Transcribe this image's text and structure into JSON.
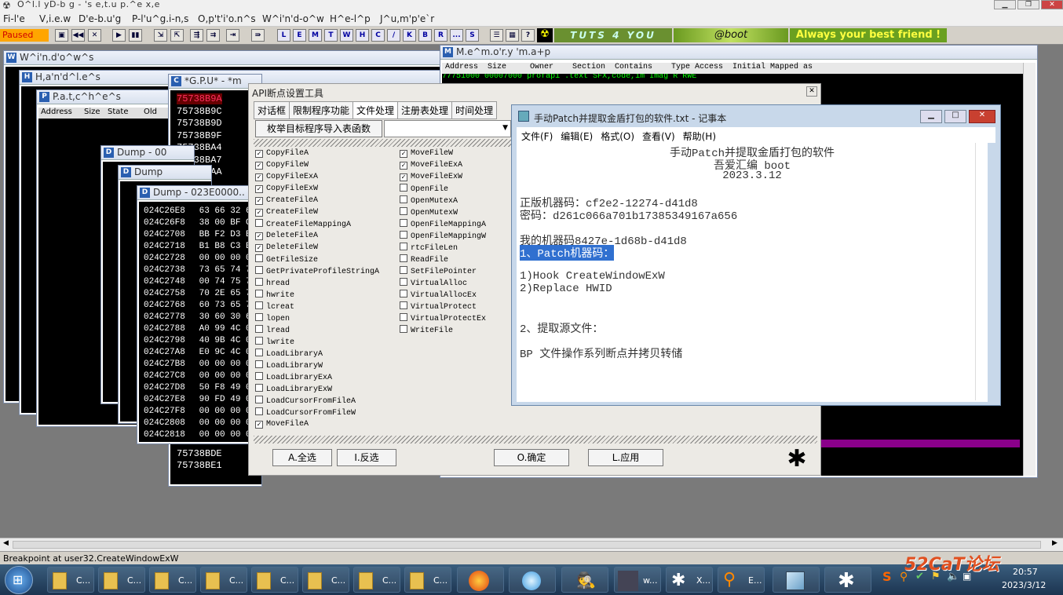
{
  "app": {
    "title": "O^l.l yD-b g - 's e,t.u p.^e x,e"
  },
  "menu": [
    "Fi-l'e",
    "V,i.e.w",
    "D'e-b.u'g",
    "P-l'u^g.i-n,s",
    "O,p't'i'o.n^s",
    "W^i'n'd-o^w",
    "H^e-l^p",
    "J^u,m'p'e`r"
  ],
  "toolbar": {
    "status": "Paused",
    "letters": [
      "L",
      "E",
      "M",
      "T",
      "W",
      "H",
      "C",
      "/",
      "K",
      "B",
      "R",
      "...",
      "S"
    ],
    "banner": "TUTS 4 YOU",
    "boot": "@boot",
    "slogan": "Always your best friend !"
  },
  "windows": {
    "windows_title": "W^i'n.d'o^w^s",
    "handles_title": "H,a'n'd^l.e^s",
    "patches_title": "P.a.t,c^h^e^s",
    "patches_cols": [
      "Address",
      "Size",
      "State",
      "Old"
    ],
    "gpu_title": "*G.P.U* - *m",
    "dump1_title": "Dump - 00",
    "dump2_title": "Dump",
    "dump3_title": "Dump - 023E0000..",
    "memory_title": "M.e^m.o'r.y 'm.a+p",
    "memory_cols": [
      "Address",
      "Size",
      "Owner",
      "Section",
      "Contains",
      "Type",
      "Access",
      "Initial",
      "Mapped as"
    ],
    "memory_row": [
      "77751000",
      "00007000",
      "profapi",
      ".text",
      "SFX,code,im",
      "Imag",
      "R",
      "RWE"
    ]
  },
  "gpu_addrs": [
    "75738B9A",
    "75738B9C",
    "75738B9D",
    "75738B9F",
    "75738BA4",
    "75738BA7",
    "75738BAA"
  ],
  "gpu_bottom": [
    "75738BDE",
    "75738BE1"
  ],
  "dump_rows": [
    [
      "024C26E8",
      "63 66 32 6"
    ],
    [
      "024C26F8",
      "38 00 BF C"
    ],
    [
      "024C2708",
      "BB F2 D3 E"
    ],
    [
      "024C2718",
      "B1 B8 C3 B"
    ],
    [
      "024C2728",
      "00 00 00 0"
    ],
    [
      "024C2738",
      "73 65 74 7"
    ],
    [
      "024C2748",
      "00 74 75 7"
    ],
    [
      "024C2758",
      "70 2E 65 7"
    ],
    [
      "024C2768",
      "60 73 65 7"
    ],
    [
      "024C2778",
      "30 60 30 6"
    ],
    [
      "024C2788",
      "A0 99 4C 0"
    ],
    [
      "024C2798",
      "40 9B 4C 0"
    ],
    [
      "024C27A8",
      "E0 9C 4C 0"
    ],
    [
      "024C27B8",
      "00 00 00 0"
    ],
    [
      "024C27C8",
      "00 00 00 0"
    ],
    [
      "024C27D8",
      "50 F8 49 0"
    ],
    [
      "024C27E8",
      "90 FD 49 0"
    ],
    [
      "024C27F8",
      "00 00 00 0"
    ],
    [
      "024C2808",
      "00 00 00 0"
    ],
    [
      "024C2818",
      "00 00 00 0"
    ]
  ],
  "api_tool": {
    "title": "API断点设置工具",
    "tabs": [
      "对话框",
      "限制程序功能",
      "文件处理",
      "注册表处理",
      "时间处理"
    ],
    "enum_button": "枚举目标程序导入表函数",
    "left": [
      {
        "name": "CopyFileA",
        "checked": true
      },
      {
        "name": "CopyFileW",
        "checked": true
      },
      {
        "name": "CopyFileExA",
        "checked": true
      },
      {
        "name": "CopyFileExW",
        "checked": true
      },
      {
        "name": "CreateFileA",
        "checked": true
      },
      {
        "name": "CreateFileW",
        "checked": true
      },
      {
        "name": "CreateFileMappingA",
        "checked": false
      },
      {
        "name": "DeleteFileA",
        "checked": true
      },
      {
        "name": "DeleteFileW",
        "checked": true
      },
      {
        "name": "GetFileSize",
        "checked": false
      },
      {
        "name": "GetPrivateProfileStringA",
        "checked": false
      },
      {
        "name": "hread",
        "checked": false
      },
      {
        "name": "hwrite",
        "checked": false
      },
      {
        "name": "lcreat",
        "checked": false
      },
      {
        "name": "lopen",
        "checked": false
      },
      {
        "name": "lread",
        "checked": false
      },
      {
        "name": "lwrite",
        "checked": false
      },
      {
        "name": "LoadLibraryA",
        "checked": false
      },
      {
        "name": "LoadLibraryW",
        "checked": false
      },
      {
        "name": "LoadLibraryExA",
        "checked": false
      },
      {
        "name": "LoadLibraryExW",
        "checked": false
      },
      {
        "name": "LoadCursorFromFileA",
        "checked": false
      },
      {
        "name": "LoadCursorFromFileW",
        "checked": false
      },
      {
        "name": "MoveFileA",
        "checked": true
      }
    ],
    "right": [
      {
        "name": "MoveFileW",
        "checked": true
      },
      {
        "name": "MoveFileExA",
        "checked": true
      },
      {
        "name": "MoveFileExW",
        "checked": true
      },
      {
        "name": "OpenFile",
        "checked": false
      },
      {
        "name": "OpenMutexA",
        "checked": false
      },
      {
        "name": "OpenMutexW",
        "checked": false
      },
      {
        "name": "OpenFileMappingA",
        "checked": false
      },
      {
        "name": "OpenFileMappingW",
        "checked": false
      },
      {
        "name": "rtcFileLen",
        "checked": false
      },
      {
        "name": "ReadFile",
        "checked": false
      },
      {
        "name": "SetFilePointer",
        "checked": false
      },
      {
        "name": "VirtualAlloc",
        "checked": false
      },
      {
        "name": "VirtualAllocEx",
        "checked": false
      },
      {
        "name": "VirtualProtect",
        "checked": false
      },
      {
        "name": "VirtualProtectEx",
        "checked": false
      },
      {
        "name": "WriteFile",
        "checked": false
      }
    ],
    "buttons": {
      "select_all": "A.全选",
      "invert": "I.反选",
      "ok": "O.确定",
      "apply": "L.应用"
    }
  },
  "notepad": {
    "title": "手动Patch并提取金盾打包的软件.txt - 记事本",
    "menu": [
      "文件(F)",
      "编辑(E)",
      "格式(O)",
      "查看(V)",
      "帮助(H)"
    ],
    "lines": {
      "l1": "手动Patch并提取金盾打包的软件",
      "l2": "吾爱汇编 boot",
      "l3": "2023.3.12",
      "l4": "正版机器码：cf2e2-12274-d41d8",
      "l5": "密码：d261c066a701b17385349167a656",
      "l6": "我的机器码8427e-1d68b-d41d8",
      "l7": "1、Patch机器码：",
      "l8": "1)Hook CreateWindowExW",
      "l9": "2)Replace HWID",
      "l10": "2、提取源文件：",
      "l11": "BP 文件操作系列断点并拷贝转储"
    }
  },
  "status": "Breakpoint at user32.CreateWindowExW",
  "taskbar": {
    "folders": [
      "C...",
      "C...",
      "C...",
      "C...",
      "C...",
      "C...",
      "C...",
      "C..."
    ],
    "w_label": "w...",
    "x_label": "X...",
    "e_label": "E...",
    "clock_time": "20:57",
    "clock_date": "2023/3/12",
    "watermark": "52CaT论坛"
  }
}
